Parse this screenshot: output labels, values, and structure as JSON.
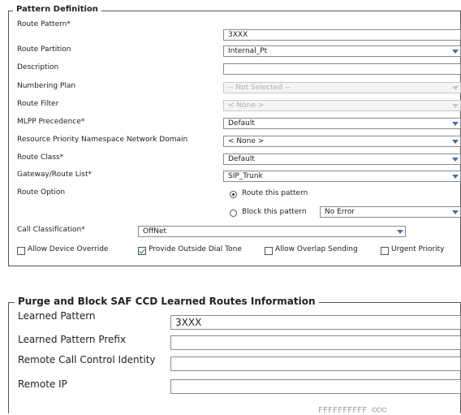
{
  "pattern_definition": {
    "legend": "Pattern Definition",
    "route_pattern": {
      "label": "Route Pattern",
      "required": "*",
      "value": "3XXX"
    },
    "route_partition": {
      "label": "Route Partition",
      "value": "Internal_Pt"
    },
    "description": {
      "label": "Description",
      "value": ""
    },
    "numbering_plan": {
      "label": "Numbering Plan",
      "value": "-- Not Selected --"
    },
    "route_filter": {
      "label": "Route Filter",
      "value": "< None >"
    },
    "mlpp_precedence": {
      "label": "MLPP Precedence",
      "required": "*",
      "value": "Default"
    },
    "resource_priority": {
      "label": "Resource Priority Namespace Network Domain",
      "value": "< None >"
    },
    "route_class": {
      "label": "Route Class",
      "required": "*",
      "value": "Default"
    },
    "gateway_route_list": {
      "label": "Gateway/Route List",
      "required": "*",
      "value": "SIP_Trunk"
    },
    "route_option": {
      "label": "Route Option",
      "route_this_pattern": "Route this pattern",
      "block_this_pattern": "Block this pattern",
      "block_reason": "No Error",
      "selected": "route_this_pattern"
    },
    "call_classification": {
      "label": "Call Classification",
      "required": "*",
      "value": "OffNet"
    },
    "checkboxes": {
      "allow_device_override": {
        "label": "Allow Device Override",
        "checked": false
      },
      "provide_outside_dial_tone": {
        "label": "Provide Outside Dial Tone",
        "checked": true
      },
      "allow_overlap_sending": {
        "label": "Allow Overlap Sending",
        "checked": false
      },
      "urgent_priority": {
        "label": "Urgent Priority",
        "checked": false
      }
    }
  },
  "purge_block": {
    "legend": "Purge and Block SAF CCD Learned Routes Information",
    "learned_pattern": {
      "label": "Learned Pattern",
      "value": "3XXX"
    },
    "learned_pattern_prefix": {
      "label": "Learned Pattern Prefix",
      "value": ""
    },
    "remote_call_control_identity": {
      "label": "Remote Call Control Identity",
      "value": ""
    },
    "remote_ip": {
      "label": "Remote IP",
      "value": ""
    }
  },
  "footer_fragment": "FFFFFFFFFF ©©©",
  "colors": {
    "select_arrow": "#4a6fa8",
    "check_mark": "#2a7a2a"
  }
}
